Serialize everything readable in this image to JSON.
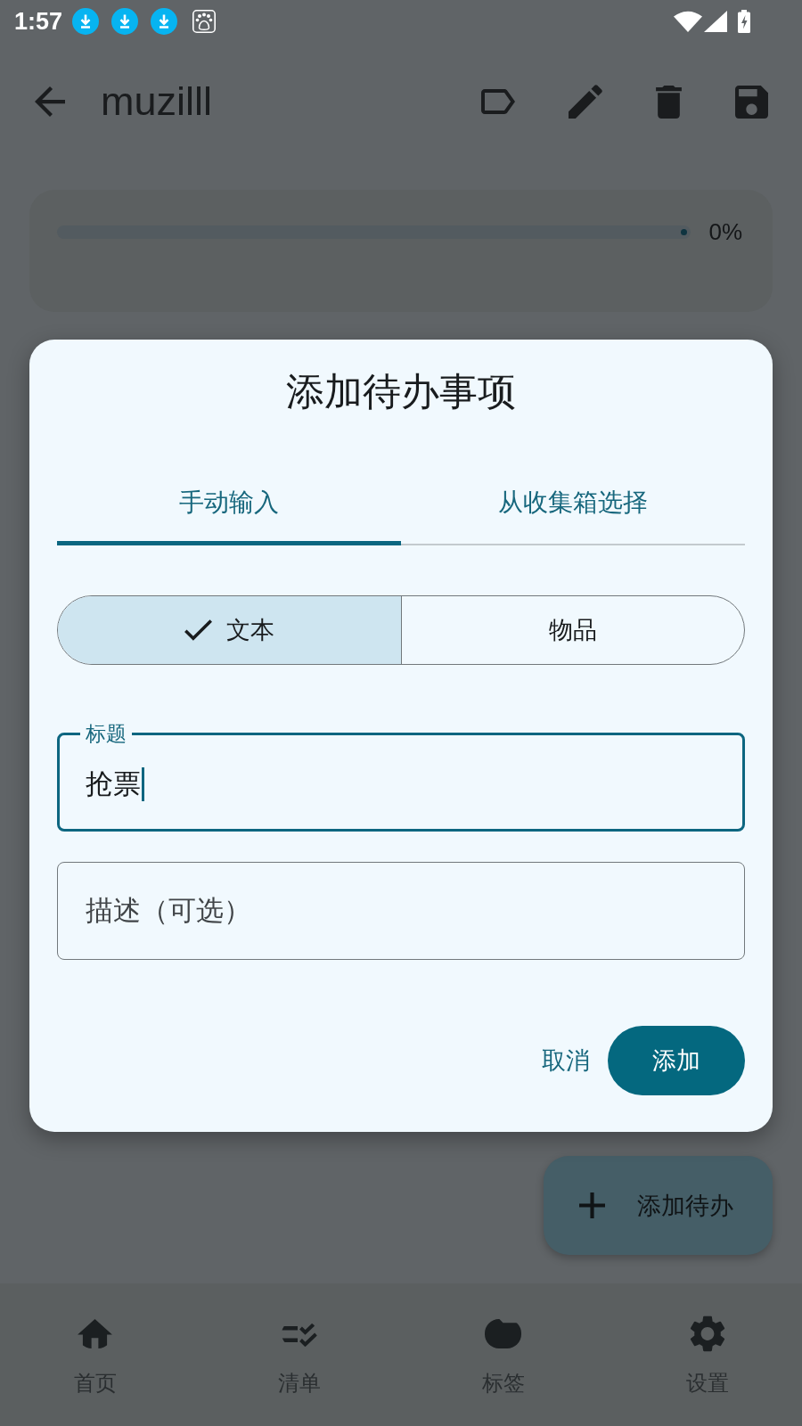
{
  "status_bar": {
    "time": "1:57"
  },
  "app_bar": {
    "title": "muzilll"
  },
  "progress": {
    "level": 0,
    "reading": "0%"
  },
  "dialog": {
    "title": "添加待办事项",
    "tabs": [
      {
        "label": "手动输入",
        "selected": true
      },
      {
        "label": "从收集箱选择",
        "selected": false
      }
    ],
    "segments": [
      {
        "label": "文本",
        "selected": true
      },
      {
        "label": "物品",
        "selected": false
      }
    ],
    "title_field": {
      "label": "标题",
      "value": "抢票",
      "focused": true
    },
    "description_field": {
      "placeholder": "描述（可选）"
    },
    "actions": [
      {
        "label": "取消",
        "kind": "text"
      },
      {
        "label": "添加",
        "kind": "filled"
      }
    ]
  },
  "fab": {
    "label": "添加待办"
  },
  "bottom_nav": [
    {
      "label": "首页",
      "selected": false
    },
    {
      "label": "清单",
      "selected": false
    },
    {
      "label": "标签",
      "selected": false
    },
    {
      "label": "设置",
      "selected": false
    }
  ]
}
